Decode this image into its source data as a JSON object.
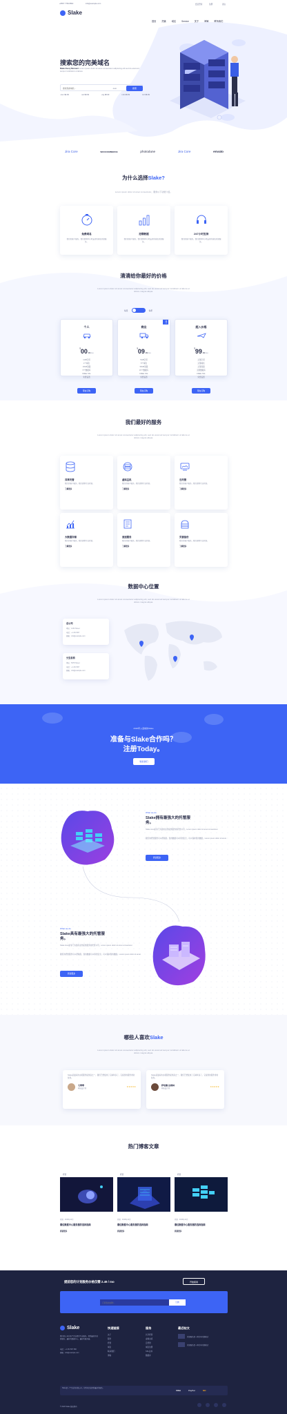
{
  "topbar": {
    "phone": "+8657 7769 8802",
    "email": "info@example.com",
    "login": "会员登录",
    "register": "注册",
    "lang": "语言"
  },
  "brand": {
    "name": "Slake"
  },
  "nav": [
    "首页",
    "托管",
    "域名",
    "Service",
    "关于",
    "博客",
    "联系我们"
  ],
  "hero": {
    "title": "搜索您的完美域名",
    "desc_lead": "Make Every Moment",
    "desc": "Lorem ipsum dolor sit amet consectetur adipiscing elit sed do eiusmod tempor incididunt ut labore",
    "search_placeholder": "搜索您的域名...",
    "tld_select": ".com",
    "search_button": "搜索",
    "tlds": [
      ".com $9.99",
      ".net $8.99",
      ".org $8.99",
      ".info $8.99",
      ".biz $8.99"
    ]
  },
  "partners": [
    "Jira Core",
    "WOOCOMMERCE",
    "photodune",
    "Jira Core",
    "envato"
  ],
  "why": {
    "title_plain": "为什么选择",
    "title_accent": "Slake?",
    "subtitle": "Lorem ipsum dolor sit amet consectetur，服务以下功能介绍。",
    "features": [
      {
        "title": "免费域名",
        "desc": "我们的客户服务，我们提供24小时支持的域名托管服务。",
        "icon": "stopwatch-icon"
      },
      {
        "title": "犯罪数据",
        "desc": "我们的客户服务，我们提供24小时支持的域名托管服务。",
        "icon": "bar-chart-icon"
      },
      {
        "title": "24/7小时支持",
        "desc": "我们的客户服务，我们提供24小时支持的域名托管服务。",
        "icon": "headset-icon"
      }
    ]
  },
  "pricing": {
    "title": "清清给你最好的价格",
    "subtitle": "Lorem ipsum dolor sit amet consectetur adipiscing elit, sed do eiusmod tempor incididunt ut labore et dolore magna aliqua.",
    "toggle_left": "每月",
    "toggle_right": "每年",
    "badge": "热门",
    "plans": [
      {
        "name": "个人",
        "currency": "$",
        "price": "00",
        "cents": ".99",
        "period": "/mo",
        "features": [
          "1GB空间",
          "1个域名",
          "10GB流量",
          "5个数据库",
          "FREE SSL",
          "免费设置"
        ],
        "button": "现在订购"
      },
      {
        "name": "商业",
        "currency": "$",
        "price": "09",
        "cents": ".99",
        "period": "/mo",
        "features": [
          "5GB空间",
          "5个域名",
          "50GB流量",
          "15个数据库",
          "FREE SSL",
          "免费设置"
        ],
        "button": "现在订购"
      },
      {
        "name": "超入价格",
        "currency": "$",
        "price": "99",
        "cents": ".99",
        "period": "/mo",
        "features": [
          "无限空间",
          "无限域名",
          "无限流量",
          "无限数据库",
          "FREE SSL",
          "免费设置"
        ],
        "button": "现在订购"
      }
    ]
  },
  "services": {
    "title": "我们最好的服务",
    "subtitle": "Lorem ipsum dolor sit amet consectetur adipiscing elit, sed do eiusmod tempor incididunt ut labore et dolore magna aliqua.",
    "items": [
      {
        "title": "共享托管",
        "desc": "我们的客户服务，我们提供专业托管。",
        "more": "了解更多",
        "icon": "database-icon"
      },
      {
        "title": "虚拟主机",
        "desc": "我们的客户服务，我们提供专业托管。",
        "more": "了解更多",
        "icon": "server-icon"
      },
      {
        "title": "云托管",
        "desc": "我们的客户服务，我们提供专业托管。",
        "more": "了解更多",
        "icon": "cloud-server-icon"
      },
      {
        "title": "大数据存储",
        "desc": "我们的客户服务，我们提供专业托管。",
        "more": "了解更多",
        "icon": "chart-icon"
      },
      {
        "title": "速送服务",
        "desc": "我们的客户服务，我们提供专业托管。",
        "more": "了解更多",
        "icon": "document-icon"
      },
      {
        "title": "灾害备份",
        "desc": "我们的客户服务，我们提供专业托管。",
        "more": "了解更多",
        "icon": "backup-icon"
      }
    ]
  },
  "datacenter": {
    "title": "数据中心位置",
    "subtitle": "Lorem ipsum dolor sit amet consectetur adipiscing elit, sed do eiusmod tempor incididunt ut labore et dolore magna aliqua.",
    "locations": [
      {
        "name": "总公司",
        "lines": [
          "地址：1234 Street",
          "电话：+1 234 567",
          "邮箱：info@example.com"
        ]
      },
      {
        "name": "分支机构",
        "lines": [
          "地址：5678 Street",
          "电话：+1 234 567",
          "邮箱：info@example.com"
        ]
      }
    ]
  },
  "cta": {
    "kicker": "2020年入选前的Slake",
    "title_line1": "准备与Slake合作吗？",
    "title_line2": "注册Today。",
    "button": "联系我们"
  },
  "about1": {
    "kicker": "What we do",
    "title": "Slake拥有最强大的托管服务。",
    "p1": "Slake Host是专门为您的业务提供服务的托管公司，Lorem ipsum dolor sit amet consectetur.",
    "p2": "我们的托管服务可以帮助您，您的数据可以得到安全，可以保护您的数据。Lorem ipsum dolor sit amet.",
    "button": "阅读更多"
  },
  "about2": {
    "kicker": "What we do",
    "title": "Slake具有最强大的托管服务。",
    "p1": "Slake Host是专门为您的业务提供服务的托管公司，Lorem ipsum dolor sit amet consectetur.",
    "p2": "我们的托管服务可以帮助您，您的数据可以得到安全，可以保护您的数据。Lorem ipsum dolor sit amet.",
    "button": "阅读更多"
  },
  "testimonials": {
    "title_plain": "哪些人喜欢",
    "title_accent": "Slake",
    "subtitle": "Lorem ipsum dolor sit amet consectetur adipiscing elit, sed do eiusmod tempor incididunt ut labore et dolore magna aliqua.",
    "items": [
      {
        "quote": "Slake是最好的主机服务提供商之一，我们已经使用了它两年多了，它提供的服务非常优秀。",
        "name": "七零零",
        "role": "网站设计师",
        "stars": "★★★★★"
      },
      {
        "quote": "Slake是最好的主机服务提供商之一，我们已经使用了它两年多了，它提供的服务非常优秀。",
        "name": "萨哈德·达维林",
        "role": "网站设计师",
        "stars": "★★★★★"
      }
    ]
  },
  "blog": {
    "title": "热门博客文章",
    "posts": [
      {
        "tag": "托管",
        "meta": "托管 · 2020年11月",
        "title": "最佳数据中心服务器的选择指南",
        "more": "阅读更多"
      },
      {
        "tag": "托管",
        "meta": "托管 · 2020年11月",
        "title": "最佳数据中心服务器的选择指南",
        "more": "阅读更多"
      },
      {
        "tag": "托管",
        "meta": "托管 · 2020年11月",
        "title": "最佳数据中心服务器的选择指南",
        "more": "阅读更多"
      }
    ]
  },
  "footer": {
    "promo": "提前您的计划服务价格仅需 2.49 / mo",
    "promo_button": "开始使用",
    "newsletter_placeholder": "订阅您的邮件...",
    "newsletter_button": "订阅",
    "about": "我们的公司为各个企业提供专业服务，提供最好的托管服务，最好的数据中心，最好的服务器。",
    "phone": "电话：+1 234 567 890",
    "email": "邮箱：info@example.com",
    "col1_title": "快速链接",
    "col1": [
      "关于",
      "服务",
      "托管",
      "域名",
      "联系我们",
      "博客"
    ],
    "col2_title": "服务",
    "col2": [
      "共享托管",
      "虚拟主机",
      "云托管",
      "域名注册",
      "SSL证书",
      "数据库"
    ],
    "col3_title": "最近帖文",
    "recent": [
      "托管服务是一种共享托管模式",
      "托管服务是一种共享托管模式"
    ],
    "bottom_note": "Slake是一个专业的托管公司，为所有企业提供最好的服务。",
    "cards": [
      "VISA",
      "PayPal",
      "MC"
    ],
    "copyright": "© 2020 Slake 版权所有"
  },
  "colors": {
    "accent": "#3d64f5",
    "dark": "#242a4a",
    "footer": "#1e2340"
  }
}
